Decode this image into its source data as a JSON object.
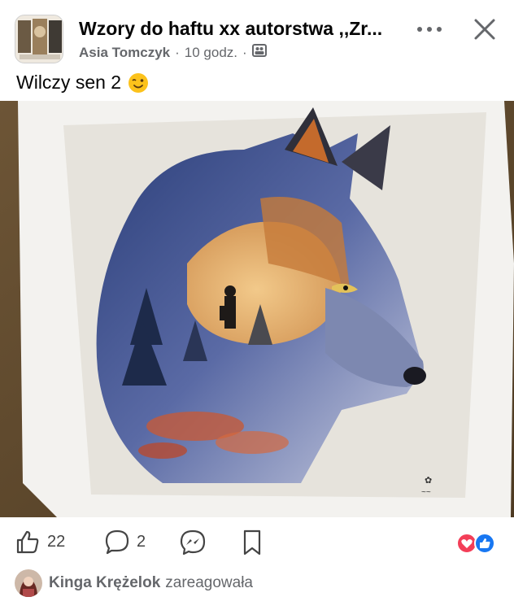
{
  "post": {
    "group_name": "Wzory do haftu xx autorstwa ,,Zr...",
    "author": "Asia Tomczyk",
    "separator": "·",
    "time": "10 godz.",
    "caption": "Wilczy sen 2"
  },
  "header_icons": {
    "more": "more-dots-icon",
    "close": "close-icon",
    "audience": "group-audience-icon"
  },
  "action_bar": {
    "like_count": "22",
    "comment_count": "2"
  },
  "reacted": {
    "name": "Kinga Krężelok",
    "verb": "zareagowała"
  },
  "colors": {
    "like_blue": "#1877f2",
    "love_red": "#f33e58",
    "secondary_text": "#65676b"
  }
}
